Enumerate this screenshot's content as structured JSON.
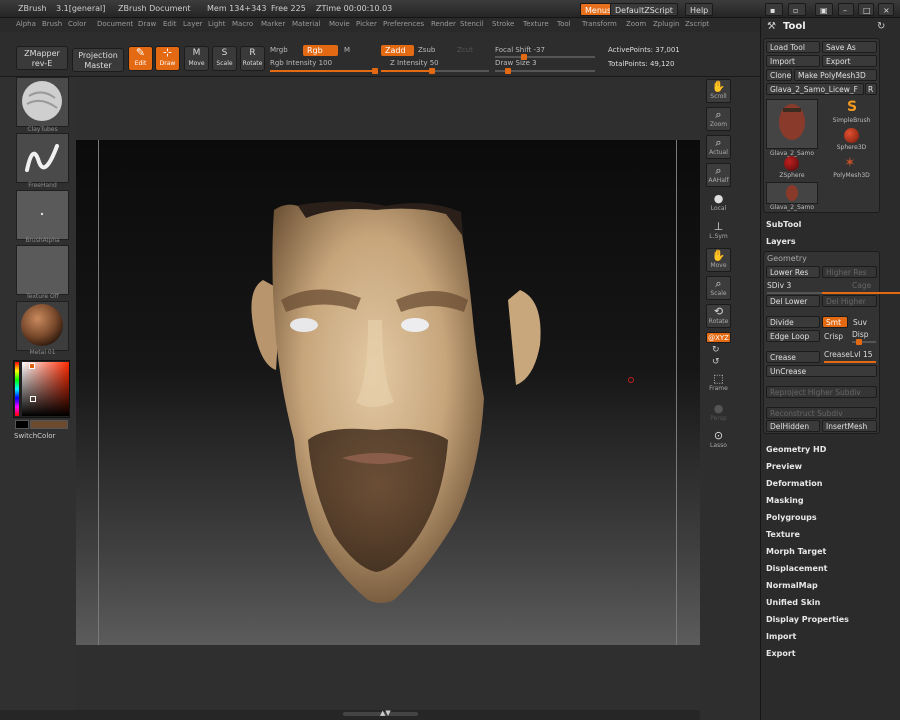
{
  "titlebar": {
    "app": "ZBrush",
    "version": "3.1[general]",
    "document": "ZBrush Document",
    "mem": "Mem 134+343",
    "free": "Free 225",
    "ztime": "ZTime 00:00:10.03",
    "menus_btn": "Menus",
    "zscript_btn": "DefaultZScript",
    "help_btn": "Help"
  },
  "menu": [
    "Alpha",
    "Brush",
    "Color",
    "Document",
    "Draw",
    "Edit",
    "Layer",
    "Light",
    "Macro",
    "Marker",
    "Material",
    "Movie",
    "Picker",
    "Preferences",
    "Render",
    "Stencil",
    "Stroke",
    "Texture",
    "Tool",
    "Transform",
    "Zoom",
    "Zplugin",
    "Zscript"
  ],
  "toolbar": {
    "zmapper_top": "ZMapper",
    "zmapper_bottom": "rev-E",
    "projection_top": "Projection",
    "projection_bottom": "Master",
    "edit": "Edit",
    "draw": "Draw",
    "move": "Move",
    "scale": "Scale",
    "rotate": "Rotate",
    "mrgb": "Mrgb",
    "rgb": "Rgb",
    "m": "M",
    "rgb_intensity": "Rgb Intensity 100",
    "rgb_intensity_value": 1.0,
    "zadd": "Zadd",
    "zsub": "Zsub",
    "zcut": "Zcut",
    "z_intensity": "Z Intensity 50",
    "z_intensity_value": 0.5,
    "focal_shift": "Focal Shift -37",
    "draw_size": "Draw Size 3",
    "active_points": "ActivePoints: 37,001",
    "total_points": "TotalPoints: 49,120"
  },
  "left_shelf": {
    "brush": "ClayTubes",
    "stroke": "FreeHand",
    "alpha": "BrushAlpha",
    "texture": "Texture Off",
    "material": "Metal 01",
    "switch_color": "SwitchColor"
  },
  "right_shelf": {
    "scroll": "Scroll",
    "zoom": "Zoom",
    "actual": "Actual",
    "aahalf": "AAHalf",
    "local": "Local",
    "lsym": "L.Sym",
    "move": "Move",
    "scale": "Scale",
    "rotate": "Rotate",
    "xyz": "@XYZ",
    "frame": "Frame",
    "persp": "Persp",
    "lasso": "Lasso"
  },
  "tool_panel": {
    "title": "Tool",
    "load_tool": "Load Tool",
    "save_as": "Save As",
    "import": "Import",
    "export": "Export",
    "clone": "Clone",
    "make_polymesh": "Make PolyMesh3D",
    "current_tool": "Glava_2_Samo_Licew_F",
    "r": "R",
    "tiles": {
      "glava": "Glava_2_Samo",
      "simplebrush": "SimpleBrush",
      "sphere3d": "Sphere3D",
      "zsphere": "ZSphere",
      "polymesh": "PolyMesh3D",
      "glava2": "Glava_2_Samo"
    },
    "subtool": "SubTool",
    "layers": "Layers",
    "geometry": "Geometry",
    "lower_res": "Lower Res",
    "higher_res": "Higher Res",
    "sdiv": "SDiv 3",
    "cage": "Cage",
    "del_lower": "Del Lower",
    "del_higher": "Del Higher",
    "divide": "Divide",
    "smt": "Smt",
    "suv": "Suv",
    "edge_loop": "Edge Loop",
    "crisp": "Crisp",
    "disp": "Disp",
    "crease": "Crease",
    "crease_lvl": "CreaseLvl 15",
    "uncrease": "UnCrease",
    "reproject": "Reproject Higher Subdiv",
    "reconstruct": "Reconstruct Subdiv",
    "delhidden": "DelHidden",
    "insertmesh": "InsertMesh",
    "sections": [
      "Geometry HD",
      "Preview",
      "Deformation",
      "Masking",
      "Polygroups",
      "Texture",
      "Morph Target",
      "Displacement",
      "NormalMap",
      "Unified Skin",
      "Display Properties",
      "Import",
      "Export"
    ]
  }
}
